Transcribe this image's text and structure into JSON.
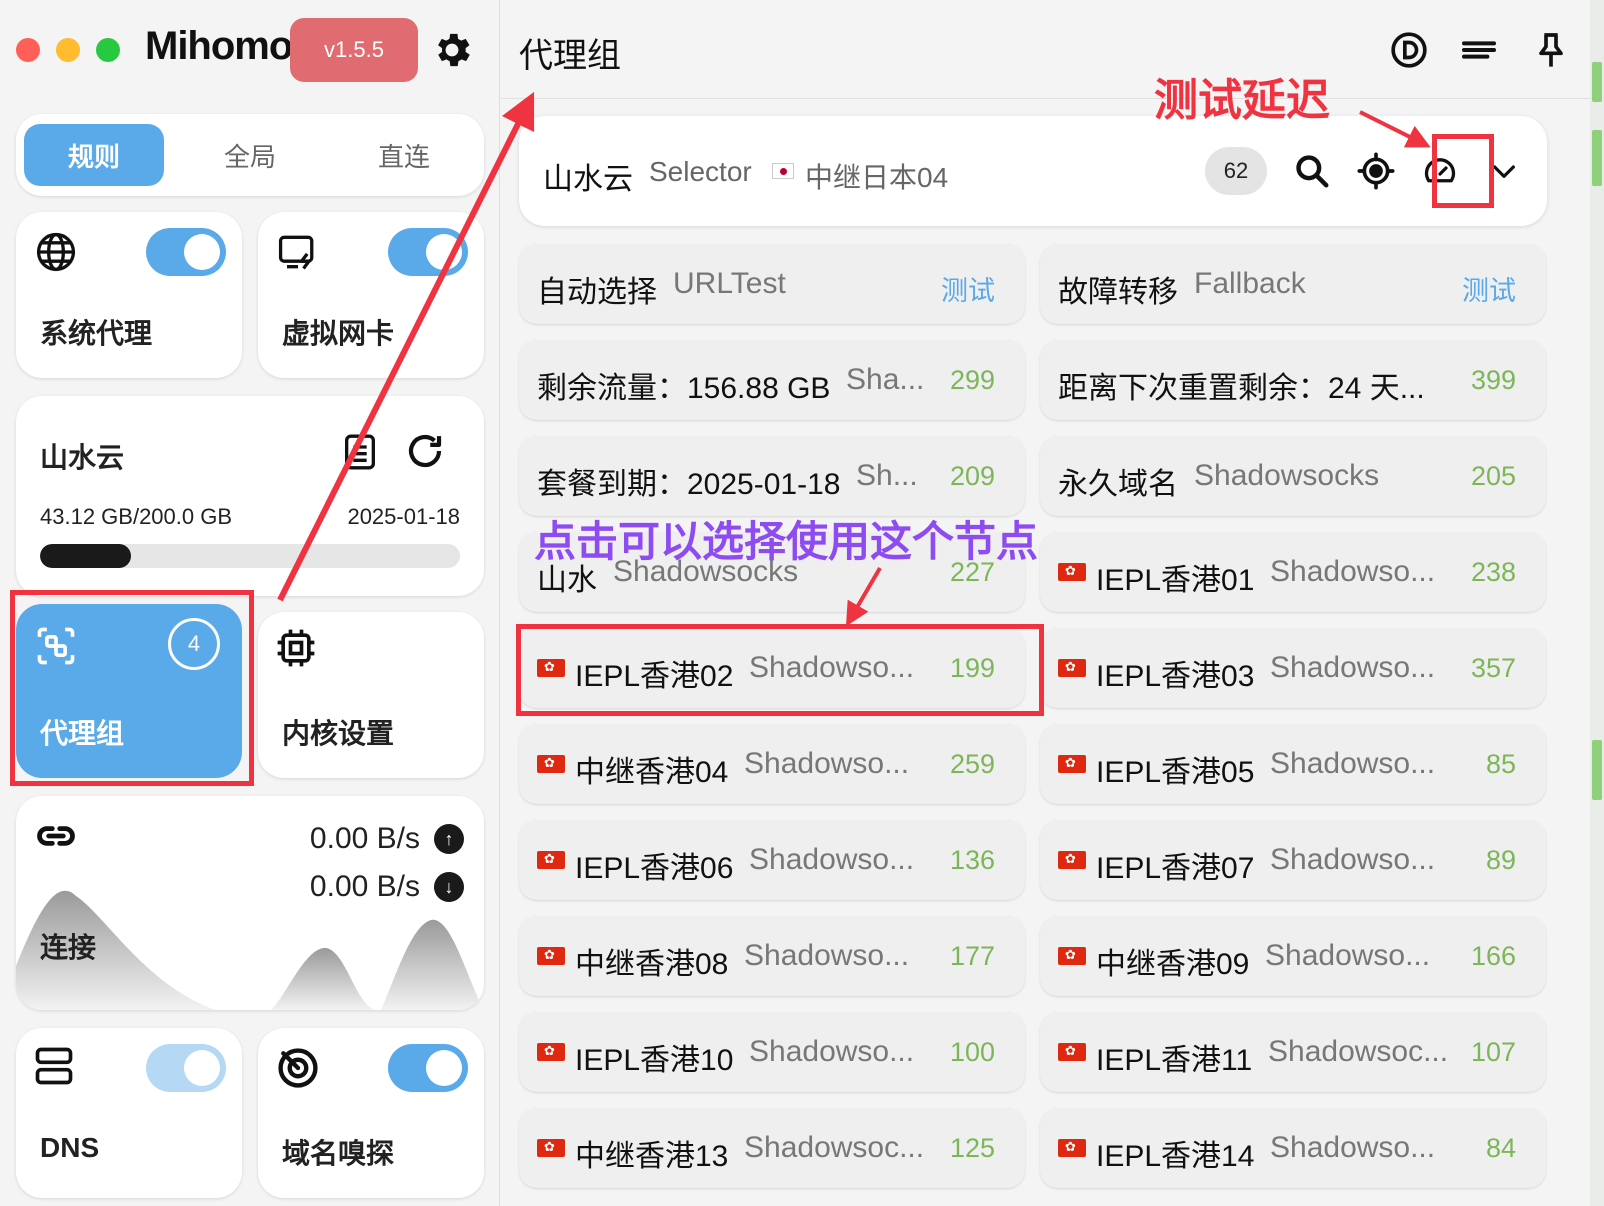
{
  "app": {
    "logo": "Mihomo",
    "version": "v1.5.5"
  },
  "mode_tabs": [
    {
      "label": "规则",
      "active": true
    },
    {
      "label": "全局",
      "active": false
    },
    {
      "label": "直连",
      "active": false
    }
  ],
  "sidebar": {
    "system_proxy": {
      "label": "系统代理",
      "enabled": true,
      "icon": "globe-icon"
    },
    "tun": {
      "label": "虚拟网卡",
      "enabled": true,
      "icon": "network-card-icon"
    },
    "subscription": {
      "name": "山水云",
      "usage": "43.12 GB/200.0 GB",
      "expire": "2025-01-18",
      "used_fraction": 0.2156
    },
    "proxy_group": {
      "label": "代理组",
      "count": "4",
      "active": true
    },
    "kernel": {
      "label": "内核设置"
    },
    "connections": {
      "label": "连接",
      "upload": "0.00 B/s",
      "download": "0.00 B/s"
    },
    "dns": {
      "label": "DNS",
      "enabled": true
    },
    "sniff": {
      "label": "域名嗅探",
      "enabled": true
    }
  },
  "main": {
    "title": "代理组",
    "group": {
      "name": "山水云",
      "type": "Selector",
      "current": "中继日本04",
      "count": "62"
    },
    "nodes": [
      {
        "name": "自动选择",
        "type": "URLTest",
        "delay": "测试",
        "flag": false,
        "is_test": true
      },
      {
        "name": "故障转移",
        "type": "Fallback",
        "delay": "测试",
        "flag": false,
        "is_test": true
      },
      {
        "name": "剩余流量：156.88 GB",
        "type": "Sha...",
        "delay": "299",
        "flag": false
      },
      {
        "name": "距离下次重置剩余：24 天...",
        "type": "",
        "delay": "399",
        "flag": false
      },
      {
        "name": "套餐到期：2025-01-18",
        "type": "Sh...",
        "delay": "209",
        "flag": false
      },
      {
        "name": "永久域名",
        "type": "Shadowsocks",
        "delay": "205",
        "flag": false
      },
      {
        "name": "山水",
        "type": "Shadowsocks",
        "delay": "227",
        "flag": false
      },
      {
        "name": "IEPL香港01",
        "type": "Shadowso...",
        "delay": "238",
        "flag": true
      },
      {
        "name": "IEPL香港02",
        "type": "Shadowso...",
        "delay": "199",
        "flag": true
      },
      {
        "name": "IEPL香港03",
        "type": "Shadowso...",
        "delay": "357",
        "flag": true
      },
      {
        "name": "中继香港04",
        "type": "Shadowso...",
        "delay": "259",
        "flag": true
      },
      {
        "name": "IEPL香港05",
        "type": "Shadowso...",
        "delay": "85",
        "flag": true
      },
      {
        "name": "IEPL香港06",
        "type": "Shadowso...",
        "delay": "136",
        "flag": true
      },
      {
        "name": "IEPL香港07",
        "type": "Shadowso...",
        "delay": "89",
        "flag": true
      },
      {
        "name": "中继香港08",
        "type": "Shadowso...",
        "delay": "177",
        "flag": true
      },
      {
        "name": "中继香港09",
        "type": "Shadowso...",
        "delay": "166",
        "flag": true
      },
      {
        "name": "IEPL香港10",
        "type": "Shadowso...",
        "delay": "100",
        "flag": true
      },
      {
        "name": "IEPL香港11",
        "type": "Shadowsoc...",
        "delay": "107",
        "flag": true
      },
      {
        "name": "中继香港13",
        "type": "Shadowsoc...",
        "delay": "125",
        "flag": true
      },
      {
        "name": "IEPL香港14",
        "type": "Shadowso...",
        "delay": "84",
        "flag": true
      }
    ]
  },
  "annotations": {
    "test_delay": "测试延迟",
    "click_select": "点击可以选择使用这个节点"
  },
  "colors": {
    "accent": "#5aa9e8",
    "annotation_red": "#ef3340",
    "annotation_purple": "#8e4bf2",
    "delay_green": "#7db658",
    "version_badge": "#e06b70"
  }
}
